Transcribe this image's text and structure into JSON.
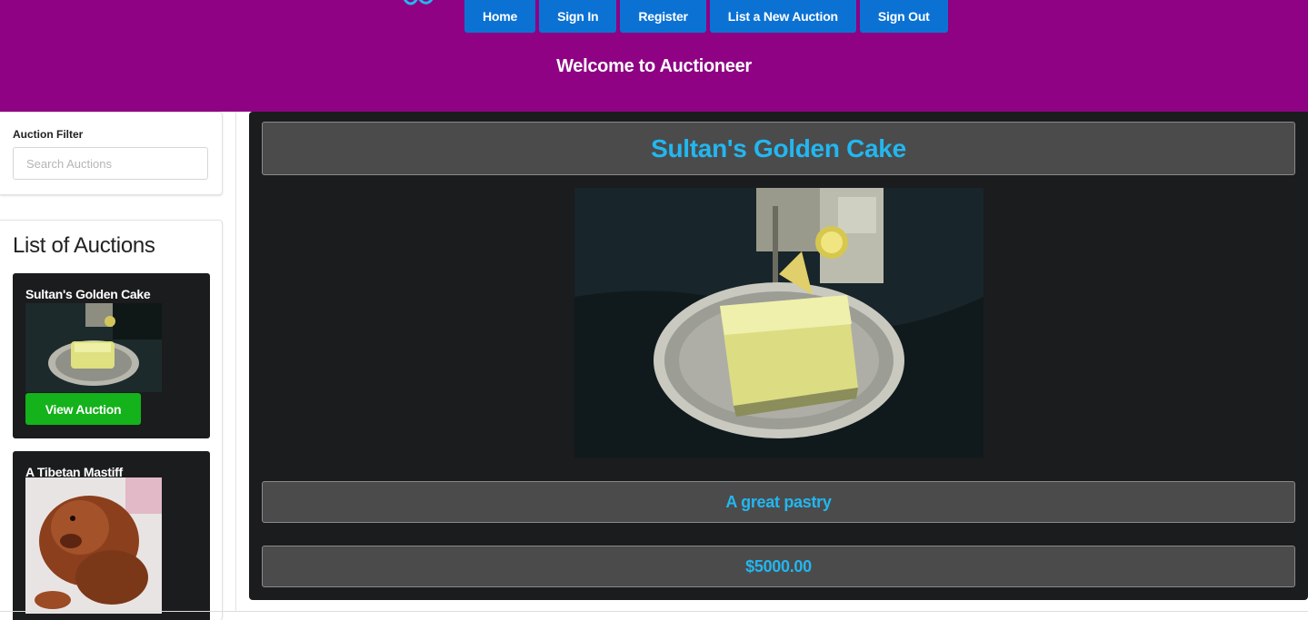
{
  "nav": {
    "items": [
      "Home",
      "Sign In",
      "Register",
      "List a New Auction",
      "Sign Out"
    ]
  },
  "header": {
    "welcome": "Welcome to Auctioneer"
  },
  "filter": {
    "label": "Auction Filter",
    "placeholder": "Search Auctions"
  },
  "list": {
    "title": "List of Auctions",
    "auctions": [
      {
        "title": "Sultan's Golden Cake",
        "button": "View Auction"
      },
      {
        "title": "A Tibetan Mastiff"
      }
    ]
  },
  "detail": {
    "title": "Sultan's Golden Cake",
    "description": "A great pastry",
    "price": "$5000.00"
  },
  "colors": {
    "header_bg": "#8e0283",
    "nav_button": "#0b72d4",
    "view_button": "#14b21b",
    "accent_text": "#22b7f0",
    "card_bg": "#1b1c1e"
  }
}
